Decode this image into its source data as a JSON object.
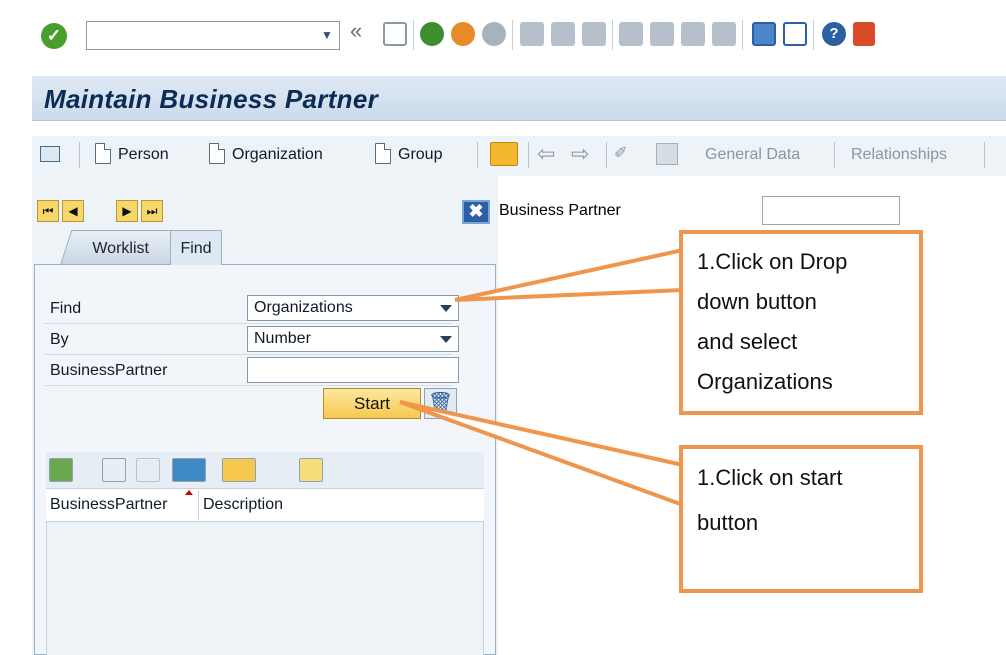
{
  "toolbar": {
    "command_value": "",
    "icons": [
      "enter-icon",
      "command-dropdown-icon",
      "collapse-icon",
      "save-icon",
      "back-icon",
      "exit-icon",
      "cancel-icon",
      "print-icon",
      "find-icon",
      "find-next-icon",
      "first-page-icon",
      "previous-page-icon",
      "next-page-icon",
      "last-page-icon",
      "create-session-icon",
      "shortcut-icon",
      "help-icon",
      "layout-menu-icon"
    ]
  },
  "title": {
    "text": "Maintain Business Partner"
  },
  "app_toolbar": {
    "person": "Person",
    "organization": "Organization",
    "group": "Group",
    "general_data": "General Data",
    "relationships": "Relationships"
  },
  "bp_field": {
    "label": "Business Partner",
    "value": ""
  },
  "tabs": {
    "worklist": "Worklist",
    "find": "Find"
  },
  "find_panel": {
    "find_label": "Find",
    "find_value": "Organizations",
    "by_label": "By",
    "by_value": "Number",
    "bp_label": "BusinessPartner",
    "bp_value": "",
    "start_label": "Start"
  },
  "grid": {
    "columns": [
      "BusinessPartner",
      "Description"
    ]
  },
  "callouts": [
    {
      "lines": [
        "1.Click on Drop",
        "down button",
        "and select",
        "Organizations"
      ]
    },
    {
      "lines": [
        "1.Click on start",
        "button"
      ]
    }
  ],
  "colors": {
    "callout_border": "#f0964c",
    "title_text": "#0c2b55",
    "start_button": "#f6c94e"
  }
}
